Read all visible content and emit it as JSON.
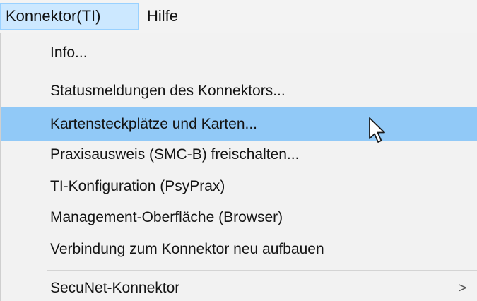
{
  "menubar": {
    "items": [
      {
        "label": "Konnektor(TI)",
        "active": true
      },
      {
        "label": "Hilfe",
        "active": false
      }
    ]
  },
  "menu": {
    "items": [
      {
        "label": "Info..."
      },
      {
        "label": "Statusmeldungen des Konnektors..."
      },
      {
        "label": "Kartensteckplätze und Karten...",
        "highlighted": true
      },
      {
        "label": "Praxisausweis (SMC-B) freischalten..."
      },
      {
        "label": "TI-Konfiguration (PsyPrax)"
      },
      {
        "label": "Management-Oberfläche (Browser)"
      },
      {
        "label": "Verbindung zum Konnektor neu aufbauen"
      }
    ],
    "submenu": {
      "label": "SecuNet-Konnektor",
      "arrow": ">"
    }
  },
  "colors": {
    "highlight": "#91c9f7",
    "menubar_active": "#cce8ff",
    "menu_background": "#f2f2f2"
  }
}
